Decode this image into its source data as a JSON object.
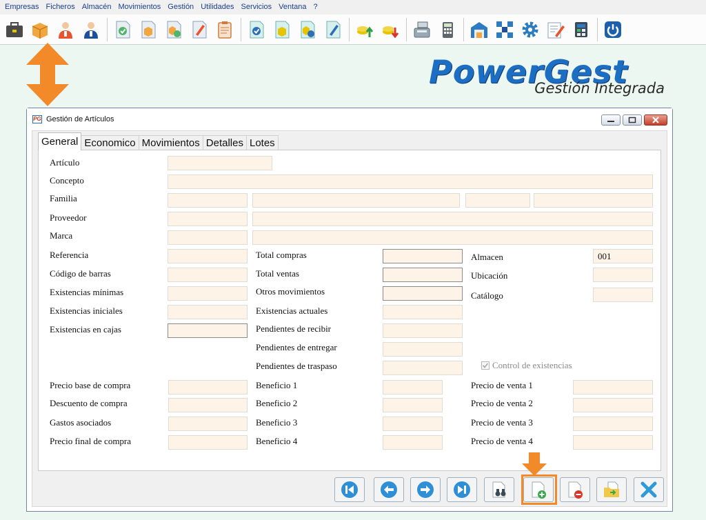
{
  "menu": [
    "Empresas",
    "Ficheros",
    "Almacén",
    "Movimientos",
    "Gestión",
    "Utilidades",
    "Servicios",
    "Ventana",
    "?"
  ],
  "toolbar_icons": [
    "briefcase-icon",
    "box-icon",
    "user-orange-icon",
    "user-blue-icon",
    "doc-check-icon",
    "doc-box-icon",
    "doc-box-check-icon",
    "doc-pencil-icon",
    "clipboard-icon",
    "doc-check-blue-icon",
    "doc-box-blue-icon",
    "doc-box-check-blue-icon",
    "doc-pencil-blue-icon",
    "coins-up-icon",
    "coins-down-icon",
    "cash-register-icon",
    "calculator-icon",
    "warehouse-icon",
    "network-icon",
    "gear-icon",
    "edit-list-icon",
    "settings-calc-icon",
    "power-icon"
  ],
  "logo": {
    "title": "PowerGest",
    "subtitle": "Gestión Integrada"
  },
  "dialog": {
    "app_icon": "PG",
    "title": "Gestión de Artículos",
    "tabs": [
      "General",
      "Economico",
      "Movimientos",
      "Detalles",
      "Lotes"
    ],
    "active_tab": "General",
    "labels": {
      "articulo": "Artículo",
      "concepto": "Concepto",
      "familia": "Familia",
      "proveedor": "Proveedor",
      "marca": "Marca",
      "referencia": "Referencia",
      "codigo_barras": "Código de barras",
      "exist_minimas": "Existencias mínimas",
      "exist_iniciales": "Existencias iniciales",
      "exist_cajas": "Existencias en cajas",
      "total_compras": "Total compras",
      "total_ventas": "Total ventas",
      "otros_mov": "Otros movimientos",
      "exist_actuales": "Existencias actuales",
      "pend_recibir": "Pendientes de recibir",
      "pend_entregar": "Pendientes de entregar",
      "pend_traspaso": "Pendientes de traspaso",
      "almacen": "Almacen",
      "ubicacion": "Ubicación",
      "catalogo": "Catálogo",
      "control_existencias": "Control de existencias",
      "precio_base": "Precio base de compra",
      "descuento": "Descuento de compra",
      "gastos": "Gastos asociados",
      "precio_final": "Precio final de compra",
      "beneficio1": "Beneficio 1",
      "beneficio2": "Beneficio 2",
      "beneficio3": "Beneficio 3",
      "beneficio4": "Beneficio 4",
      "pv1": "Precio de venta 1",
      "pv2": "Precio de venta 2",
      "pv3": "Precio de venta 3",
      "pv4": "Precio de venta 4"
    },
    "values": {
      "almacen": "001"
    },
    "control_existencias_checked": true,
    "nav_buttons": [
      "first-record-button",
      "previous-record-button",
      "next-record-button",
      "last-record-button",
      "search-button",
      "new-record-button",
      "delete-record-button",
      "open-folder-button",
      "close-form-button"
    ]
  }
}
